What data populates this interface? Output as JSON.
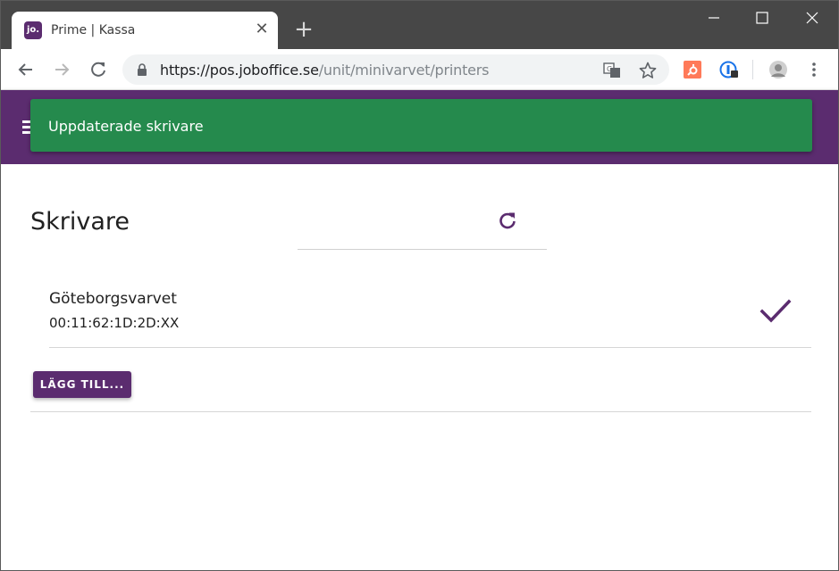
{
  "browser": {
    "tab_title": "Prime | Kassa",
    "favicon_text": "jo.",
    "url_host": "https://pos.joboffice.se",
    "url_path": "/unit/minivarvet/printers",
    "new_tab_label": "+",
    "tab_close_label": "✕"
  },
  "toast": {
    "message": "Uppdaterade skrivare"
  },
  "page": {
    "title": "Skrivare"
  },
  "printers": [
    {
      "name": "Göteborgsvarvet",
      "mac": "00:11:62:1D:2D:XX",
      "selected": true
    }
  ],
  "actions": {
    "add_label": "LÄGG TILL..."
  },
  "colors": {
    "brand": "#5b2c6f",
    "toast": "#258a4d",
    "titlebar": "#474747"
  },
  "icons": {
    "refresh": "refresh-icon",
    "check": "checkmark-icon",
    "menu": "hamburger-icon"
  }
}
